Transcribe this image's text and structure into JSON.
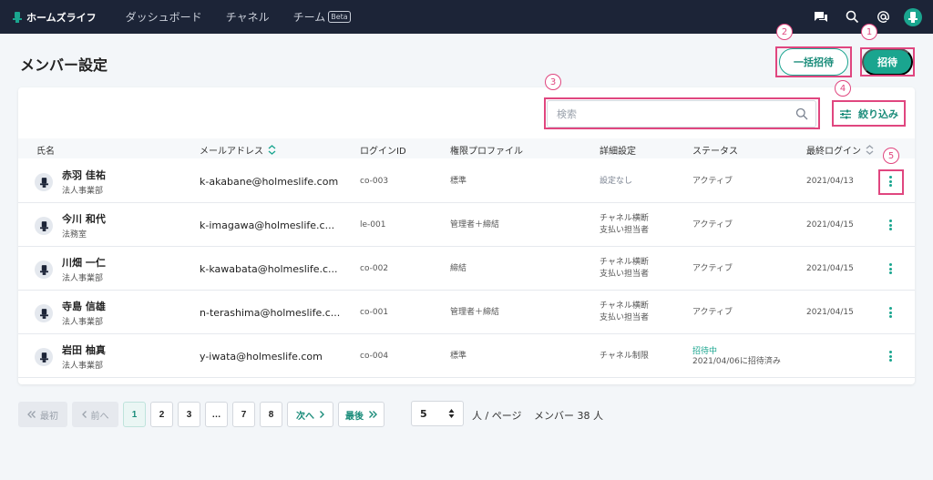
{
  "topbar": {
    "brand": "ホームズライフ",
    "nav": [
      "ダッシュボード",
      "チャネル",
      "チーム"
    ],
    "beta_badge": "Beta",
    "icons": [
      "chat-icon",
      "search-icon",
      "mention-icon",
      "user-avatar-icon"
    ]
  },
  "page": {
    "title": "メンバー設定",
    "bulk_invite_label": "一括招待",
    "invite_label": "招待"
  },
  "search": {
    "placeholder": "検索",
    "value": ""
  },
  "filter": {
    "label": "絞り込み",
    "icon": "sliders-icon"
  },
  "annotations": [
    "1",
    "2",
    "3",
    "4",
    "5"
  ],
  "table": {
    "headers": [
      "氏名",
      "メールアドレス",
      "ログインID",
      "権限プロファイル",
      "詳細設定",
      "ステータス",
      "最終ログイン"
    ],
    "rows": [
      {
        "name": "赤羽 佳祐",
        "dept": "法人事業部",
        "email": "k-akabane@holmeslife.com",
        "login_id": "co-003",
        "profile": "標準",
        "detail1": "設定なし",
        "detail2": "",
        "status1": "アクティブ",
        "status2": "",
        "last_login": "2021/04/13"
      },
      {
        "name": "今川 和代",
        "dept": "法務室",
        "email": "k-imagawa@holmeslife.c...",
        "login_id": "le-001",
        "profile": "管理者＋締結",
        "detail1": "チャネル横断",
        "detail2": "支払い担当者",
        "status1": "アクティブ",
        "status2": "",
        "last_login": "2021/04/15"
      },
      {
        "name": "川畑 一仁",
        "dept": "法人事業部",
        "email": "k-kawabata@holmeslife.c...",
        "login_id": "co-002",
        "profile": "締結",
        "detail1": "チャネル横断",
        "detail2": "支払い担当者",
        "status1": "アクティブ",
        "status2": "",
        "last_login": "2021/04/15"
      },
      {
        "name": "寺島 信雄",
        "dept": "法人事業部",
        "email": "n-terashima@holmeslife.c...",
        "login_id": "co-001",
        "profile": "管理者＋締結",
        "detail1": "チャネル横断",
        "detail2": "支払い担当者",
        "status1": "アクティブ",
        "status2": "",
        "last_login": "2021/04/15"
      },
      {
        "name": "岩田 柚真",
        "dept": "法人事業部",
        "email": "y-iwata@holmeslife.com",
        "login_id": "co-004",
        "profile": "標準",
        "detail1": "チャネル制限",
        "detail2": "",
        "status1": "招待中",
        "status2": "2021/04/06に招待済み",
        "last_login": ""
      }
    ]
  },
  "pagination": {
    "first_label": "最初",
    "prev_label": "前へ",
    "pages": [
      "1",
      "2",
      "3",
      "…",
      "7",
      "8"
    ],
    "current_page": "1",
    "next_label": "次へ",
    "last_label": "最後",
    "per_page": "5",
    "per_page_label": "人 / ページ",
    "member_count": "メンバー 38 人"
  },
  "colors": {
    "accent": "#1aa58f",
    "topbar": "#1c2437",
    "annotation": "#e0467f"
  }
}
